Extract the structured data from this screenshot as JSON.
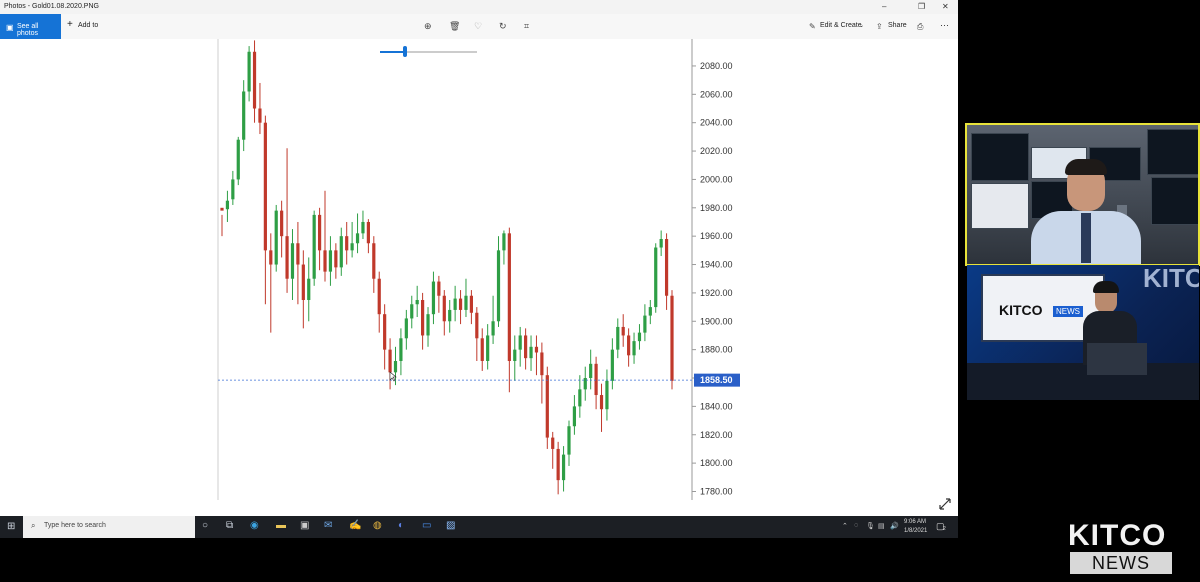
{
  "window": {
    "title": "Photos - Gold01.08.2020.PNG",
    "minimize": "–",
    "maximize": "❐",
    "close": "✕"
  },
  "toolbar": {
    "see_all_photos": "See all photos",
    "add_to": "Add to",
    "edit_create": "Edit & Create",
    "share": "Share",
    "more": "···"
  },
  "taskbar": {
    "search_placeholder": "Type here to search",
    "time": "9:06 AM",
    "date": "1/8/2021",
    "notifications": "2"
  },
  "chart_data": {
    "type": "candlestick",
    "y_ticks": [
      "2080.00",
      "2060.00",
      "2040.00",
      "2020.00",
      "2000.00",
      "1980.00",
      "1960.00",
      "1940.00",
      "1920.00",
      "1900.00",
      "1880.00",
      "1860.00",
      "1840.00",
      "1820.00",
      "1800.00",
      "1780.00"
    ],
    "ylim": [
      1774,
      2099
    ],
    "current_price": 1858.5,
    "current_price_label": "1858.50",
    "up_color": "#2e9e45",
    "down_color": "#c0392b",
    "candles": [
      [
        1980,
        1978,
        1975,
        1960
      ],
      [
        1979,
        1985,
        1992,
        1970
      ],
      [
        1986,
        2000,
        2006,
        1982
      ],
      [
        2000,
        2028,
        2030,
        1996
      ],
      [
        2028,
        2062,
        2070,
        2020
      ],
      [
        2062,
        2090,
        2094,
        2055
      ],
      [
        2090,
        2050,
        2098,
        2040
      ],
      [
        2050,
        2040,
        2068,
        2032
      ],
      [
        2040,
        1950,
        2045,
        1912
      ],
      [
        1950,
        1940,
        1962,
        1892
      ],
      [
        1940,
        1978,
        1982,
        1935
      ],
      [
        1978,
        1960,
        1985,
        1945
      ],
      [
        1960,
        1930,
        2022,
        1920
      ],
      [
        1930,
        1955,
        1965,
        1915
      ],
      [
        1955,
        1940,
        1970,
        1912
      ],
      [
        1940,
        1915,
        1950,
        1895
      ],
      [
        1915,
        1930,
        1945,
        1900
      ],
      [
        1930,
        1975,
        1978,
        1925
      ],
      [
        1975,
        1950,
        1980,
        1936
      ],
      [
        1950,
        1935,
        1992,
        1928
      ],
      [
        1935,
        1950,
        1960,
        1925
      ],
      [
        1950,
        1938,
        1955,
        1930
      ],
      [
        1938,
        1960,
        1966,
        1932
      ],
      [
        1960,
        1950,
        1970,
        1940
      ],
      [
        1950,
        1955,
        1970,
        1945
      ],
      [
        1955,
        1962,
        1976,
        1948
      ],
      [
        1962,
        1970,
        1978,
        1958
      ],
      [
        1970,
        1955,
        1972,
        1948
      ],
      [
        1955,
        1930,
        1960,
        1920
      ],
      [
        1930,
        1905,
        1935,
        1892
      ],
      [
        1905,
        1880,
        1912,
        1866
      ],
      [
        1880,
        1864,
        1888,
        1852
      ],
      [
        1864,
        1872,
        1882,
        1855
      ],
      [
        1872,
        1888,
        1895,
        1862
      ],
      [
        1888,
        1902,
        1908,
        1880
      ],
      [
        1902,
        1912,
        1918,
        1895
      ],
      [
        1912,
        1915,
        1925,
        1903
      ],
      [
        1915,
        1890,
        1920,
        1880
      ],
      [
        1890,
        1905,
        1910,
        1882
      ],
      [
        1905,
        1928,
        1935,
        1898
      ],
      [
        1928,
        1918,
        1932,
        1906
      ],
      [
        1918,
        1900,
        1922,
        1890
      ],
      [
        1900,
        1908,
        1915,
        1892
      ],
      [
        1908,
        1916,
        1925,
        1900
      ],
      [
        1916,
        1908,
        1922,
        1898
      ],
      [
        1908,
        1918,
        1930,
        1903
      ],
      [
        1918,
        1906,
        1922,
        1898
      ],
      [
        1906,
        1888,
        1910,
        1872
      ],
      [
        1888,
        1872,
        1895,
        1865
      ],
      [
        1872,
        1890,
        1898,
        1866
      ],
      [
        1890,
        1900,
        1918,
        1884
      ],
      [
        1900,
        1950,
        1960,
        1896
      ],
      [
        1950,
        1962,
        1964,
        1940
      ],
      [
        1962,
        1872,
        1966,
        1850
      ],
      [
        1872,
        1880,
        1890,
        1858
      ],
      [
        1880,
        1890,
        1896,
        1868
      ],
      [
        1890,
        1874,
        1895,
        1866
      ],
      [
        1874,
        1882,
        1890,
        1865
      ],
      [
        1882,
        1878,
        1890,
        1862
      ],
      [
        1878,
        1862,
        1885,
        1842
      ],
      [
        1862,
        1818,
        1868,
        1810
      ],
      [
        1818,
        1810,
        1822,
        1796
      ],
      [
        1810,
        1788,
        1815,
        1778
      ],
      [
        1788,
        1806,
        1812,
        1780
      ],
      [
        1806,
        1826,
        1830,
        1798
      ],
      [
        1826,
        1840,
        1848,
        1820
      ],
      [
        1840,
        1852,
        1862,
        1832
      ],
      [
        1852,
        1860,
        1868,
        1844
      ],
      [
        1860,
        1870,
        1880,
        1852
      ],
      [
        1870,
        1848,
        1875,
        1838
      ],
      [
        1848,
        1838,
        1856,
        1822
      ],
      [
        1838,
        1858,
        1866,
        1830
      ],
      [
        1858,
        1880,
        1888,
        1852
      ],
      [
        1880,
        1896,
        1902,
        1874
      ],
      [
        1896,
        1890,
        1905,
        1882
      ],
      [
        1890,
        1876,
        1895,
        1868
      ],
      [
        1876,
        1886,
        1892,
        1870
      ],
      [
        1886,
        1892,
        1898,
        1880
      ],
      [
        1892,
        1904,
        1912,
        1886
      ],
      [
        1904,
        1910,
        1915,
        1898
      ],
      [
        1910,
        1952,
        1955,
        1906
      ],
      [
        1952,
        1958,
        1964,
        1946
      ],
      [
        1958,
        1918,
        1962,
        1908
      ],
      [
        1918,
        1858,
        1922,
        1852
      ]
    ]
  },
  "kitco": {
    "tv_logo": "KITCO",
    "tv_logo_news": "NEWS",
    "wall_text": "KITCO",
    "logo_top": "KITCO",
    "logo_bottom": "NEWS"
  }
}
